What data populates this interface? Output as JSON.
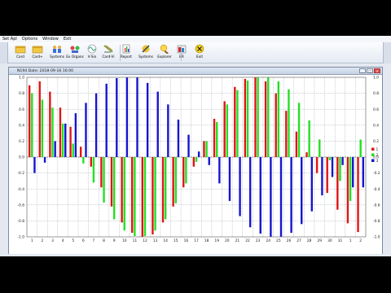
{
  "menu": [
    "Set Apl",
    "Options",
    "Window",
    "Exit"
  ],
  "toolbar": [
    {
      "label": "Card",
      "icon": "card-icon"
    },
    {
      "label": "Card+",
      "icon": "card-plus-icon"
    },
    {
      "label": "Systems",
      "icon": "people-icon"
    },
    {
      "label": "Ex Organs",
      "icon": "organs-icon"
    },
    {
      "label": "V-Sin",
      "icon": "v-sin-icon"
    },
    {
      "label": "Card-Vi",
      "icon": "card-vi-icon"
    },
    {
      "label": "Report",
      "icon": "report-icon"
    },
    {
      "label": "Systems",
      "icon": "systems-icon"
    },
    {
      "label": "Explorer",
      "icon": "explorer-icon"
    },
    {
      "label": "BR",
      "icon": "br-icon"
    },
    {
      "label": "Exit",
      "icon": "exit-icon"
    }
  ],
  "window": {
    "title": "N194 Date: 2018-09-16 16:00",
    "buttons": [
      "_",
      "□",
      "×"
    ]
  },
  "colors": {
    "series1": "#e01515",
    "series2": "#22e022",
    "series3": "#1515d0",
    "grid": "#9aa0a8"
  },
  "chart_data": {
    "type": "bar",
    "categories": [
      "1",
      "2",
      "3",
      "4",
      "5",
      "6",
      "7",
      "8",
      "9",
      "10",
      "11",
      "12",
      "13",
      "14",
      "15",
      "16",
      "17",
      "18",
      "19",
      "20",
      "21",
      "22",
      "23",
      "24",
      "25",
      "26",
      "27",
      "28",
      "29",
      "30",
      "31",
      "1",
      "2"
    ],
    "ylim": [
      -1.0,
      1.0
    ],
    "yticks": [
      1.0,
      0.8,
      0.6,
      0.4,
      0.2,
      0.0,
      -0.2,
      -0.4,
      -0.6,
      -0.8,
      -1.0
    ],
    "grid": true,
    "legend": "right",
    "series": [
      {
        "name": "1",
        "values": [
          0.9,
          0.95,
          0.82,
          0.62,
          0.38,
          0.13,
          -0.12,
          -0.38,
          -0.62,
          -0.82,
          -0.95,
          -1.0,
          -0.97,
          -0.82,
          -0.62,
          -0.38,
          -0.12,
          0.2,
          0.48,
          0.7,
          0.88,
          0.98,
          1.0,
          0.95,
          0.8,
          0.58,
          0.32,
          0.06,
          -0.2,
          -0.45,
          -0.66,
          -0.83,
          -0.94
        ]
      },
      {
        "name": "2",
        "values": [
          0.8,
          0.72,
          0.62,
          0.42,
          0.17,
          -0.08,
          -0.32,
          -0.57,
          -0.78,
          -0.92,
          -0.99,
          -0.99,
          -0.92,
          -0.78,
          -0.58,
          -0.33,
          -0.06,
          0.2,
          0.44,
          0.66,
          0.84,
          0.96,
          1.0,
          1.0,
          0.95,
          0.85,
          0.68,
          0.46,
          0.22,
          -0.04,
          -0.3,
          -0.55,
          0.22
        ]
      },
      {
        "name": "3",
        "values": [
          -0.2,
          -0.07,
          0.2,
          0.42,
          0.55,
          0.68,
          0.8,
          0.92,
          0.99,
          1.0,
          1.0,
          0.93,
          0.82,
          0.66,
          0.47,
          0.28,
          0.07,
          -0.1,
          -0.33,
          -0.55,
          -0.74,
          -0.88,
          -0.96,
          -1.0,
          -1.0,
          -0.95,
          -0.84,
          -0.68,
          -0.48,
          -0.25,
          -0.1,
          -0.38,
          -0.38
        ]
      }
    ]
  }
}
